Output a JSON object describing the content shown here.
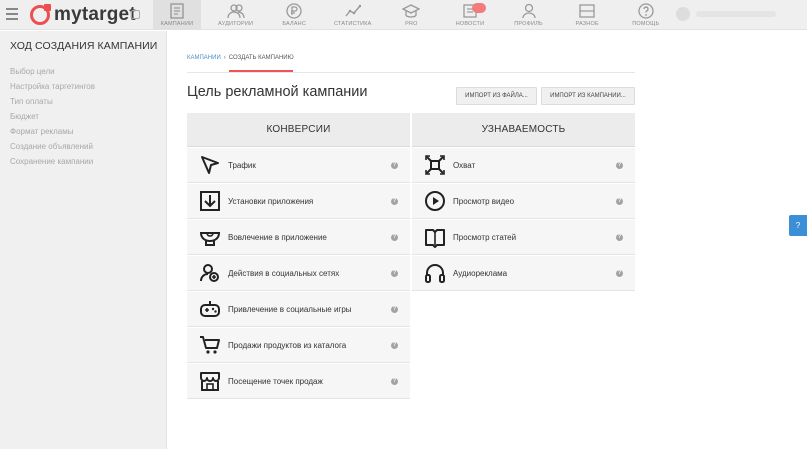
{
  "app": {
    "logo_text": "mytarget"
  },
  "nav": {
    "items": [
      {
        "label": "Кампании",
        "icon": "campaigns-icon",
        "active": true
      },
      {
        "label": "Аудитории",
        "icon": "audiences-icon"
      },
      {
        "label": "Баланс",
        "icon": "balance-icon"
      },
      {
        "label": "Статистика",
        "icon": "statistics-icon"
      },
      {
        "label": "PRO",
        "icon": "pro-icon"
      },
      {
        "label": "Новости",
        "icon": "news-icon"
      },
      {
        "label": "Профиль",
        "icon": "profile-icon"
      },
      {
        "label": "Разное",
        "icon": "misc-icon"
      },
      {
        "label": "Помощь",
        "icon": "help-icon"
      }
    ]
  },
  "sidebar": {
    "title": "ХОД СОЗДАНИЯ КАМПАНИИ",
    "items": [
      "Выбор цели",
      "Настройка таргетингов",
      "Тип оплаты",
      "Бюджет",
      "Формат рекламы",
      "Создание объявлений",
      "Сохранение кампании"
    ]
  },
  "breadcrumb": {
    "root": "КАМПАНИИ",
    "separator": "›",
    "current": "СОЗДАТЬ КАМПАНИЮ"
  },
  "page": {
    "title": "Цель рекламной кампании",
    "import_file_label": "ИМПОРТ ИЗ ФАЙЛА...",
    "import_campaign_label": "ИМПОРТ ИЗ КАМПАНИИ..."
  },
  "goals": {
    "conversions": {
      "header": "КОНВЕРСИИ",
      "items": [
        {
          "label": "Трафик",
          "icon": "cursor-icon"
        },
        {
          "label": "Установки приложения",
          "icon": "download-icon"
        },
        {
          "label": "Вовлечение в приложение",
          "icon": "engagement-icon"
        },
        {
          "label": "Действия в социальных сетях",
          "icon": "social-icon"
        },
        {
          "label": "Привлечение в социальные игры",
          "icon": "gamepad-icon"
        },
        {
          "label": "Продажи продуктов из каталога",
          "icon": "cart-icon"
        },
        {
          "label": "Посещение точек продаж",
          "icon": "store-icon"
        }
      ]
    },
    "awareness": {
      "header": "УЗНАВАЕМОСТЬ",
      "items": [
        {
          "label": "Охват",
          "icon": "reach-icon"
        },
        {
          "label": "Просмотр видео",
          "icon": "play-icon"
        },
        {
          "label": "Просмотр статей",
          "icon": "article-icon"
        },
        {
          "label": "Аудиореклама",
          "icon": "headphones-icon"
        }
      ]
    },
    "help_glyph": "?"
  },
  "help_tab": {
    "label": "?"
  },
  "colors": {
    "accent": "#ee4e4e",
    "link": "#4a90c8",
    "help": "#3a8fd6"
  }
}
